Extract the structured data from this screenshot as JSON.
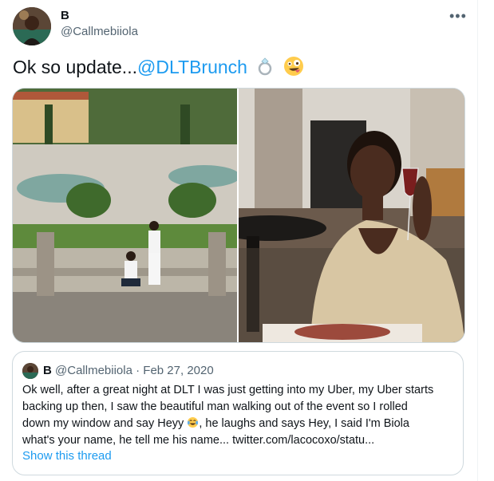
{
  "author": {
    "name": "B",
    "handle": "@Callmebiiola"
  },
  "tweet": {
    "text": "Ok so update...",
    "mention": "@DLTBrunch",
    "emojis": [
      "ring-emoji",
      "zany-face-emoji"
    ]
  },
  "media": {
    "left_photo": "garden-proposal-photo",
    "right_photo": "woman-with-wine-glass-photo"
  },
  "quote": {
    "name": "B",
    "handle": "@Callmebiiola",
    "separator": "·",
    "date": "Feb 27, 2020",
    "lines": [
      "Ok well, after a great night at DLT I was just getting into my Uber, my Uber starts",
      "backing up then, I saw the beautiful man walking out of the event so I rolled",
      "down my window and say Heyy",
      ", he laughs and says Hey, I said I'm Biola",
      "what's your name, he tell me his name... twitter.com/lacocoxo/statu..."
    ],
    "show_thread": "Show this thread"
  },
  "colors": {
    "link": "#1d9bf0",
    "secondary_text": "#536471",
    "border": "#cfd9de"
  }
}
